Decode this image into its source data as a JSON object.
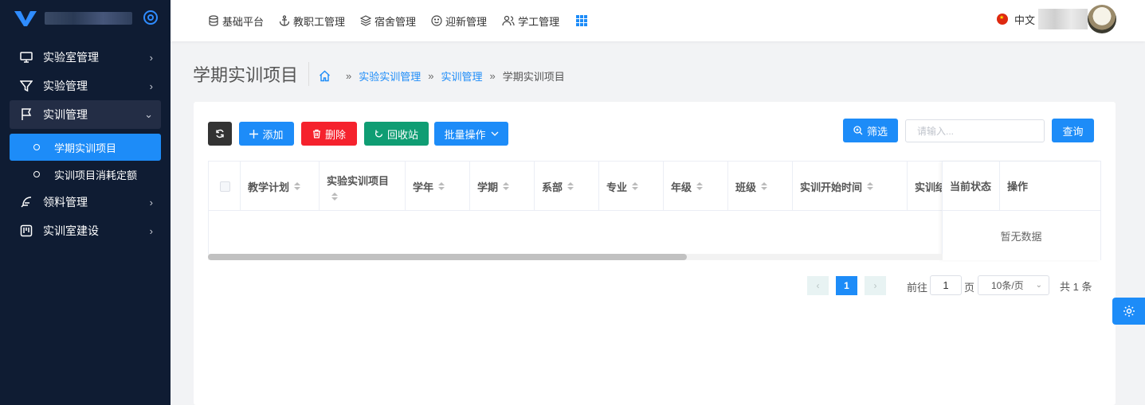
{
  "sidebar": {
    "menu": [
      {
        "label": "实验室管理",
        "icon": "monitor-icon",
        "expanded": false
      },
      {
        "label": "实验管理",
        "icon": "filter-icon",
        "expanded": false
      },
      {
        "label": "实训管理",
        "icon": "flag-icon",
        "expanded": true,
        "children": [
          {
            "label": "学期实训项目",
            "active": true
          },
          {
            "label": "实训项目消耗定额",
            "active": false
          }
        ]
      },
      {
        "label": "领料管理",
        "icon": "feather-icon",
        "expanded": false
      },
      {
        "label": "实训室建设",
        "icon": "board-icon",
        "expanded": false
      }
    ]
  },
  "topnav": [
    {
      "label": "基础平台",
      "icon": "database-icon"
    },
    {
      "label": "教职工管理",
      "icon": "anchor-icon"
    },
    {
      "label": "宿舍管理",
      "icon": "layers-icon"
    },
    {
      "label": "迎新管理",
      "icon": "smile-icon"
    },
    {
      "label": "学工管理",
      "icon": "users-icon"
    }
  ],
  "language": "中文",
  "page": {
    "title": "学期实训项目",
    "breadcrumb": [
      "实验实训管理",
      "实训管理",
      "学期实训项目"
    ]
  },
  "toolbar": {
    "add": "添加",
    "delete": "删除",
    "recycle": "回收站",
    "batch": "批量操作",
    "filter": "筛选",
    "search_placeholder": "请输入...",
    "query": "查询"
  },
  "table": {
    "columns": [
      "教学计划",
      "实验实训项目",
      "学年",
      "学期",
      "系部",
      "专业",
      "年级",
      "班级",
      "实训开始时间",
      "实训结"
    ],
    "fixed_columns": [
      "当前状态",
      "操作"
    ],
    "empty_text": "暂无数据"
  },
  "pagination": {
    "current_page": "1",
    "goto_label": "前往",
    "goto_value": "1",
    "page_label": "页",
    "page_size": "10条/页",
    "total": "共 1 条"
  },
  "colors": {
    "primary": "#1d8cf8",
    "danger": "#f5222d",
    "success": "#0f9d73",
    "sidebar_bg": "#0f1c33"
  }
}
